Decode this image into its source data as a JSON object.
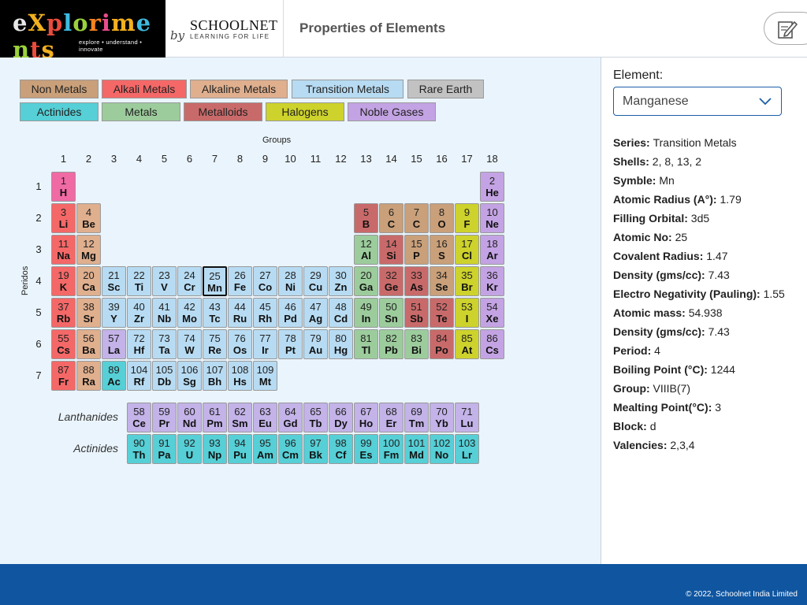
{
  "header": {
    "logo_text": "explorim",
    "logo_letters": [
      "e",
      "X",
      "p",
      "l",
      "o",
      "r",
      "i",
      "m",
      "e",
      "n",
      "t",
      "s"
    ],
    "logo_tagline": "explore • understand • innovate",
    "by_text": "by",
    "partner_name": "SCHOOLNET",
    "partner_tagline": "LEARNING FOR LIFE",
    "title": "Properties of Elements",
    "edit_icon": "pencil-notepad-icon"
  },
  "legend": [
    {
      "label": "Non Metals",
      "color": "#c9a07a"
    },
    {
      "label": "Alkali Metals",
      "color": "#f46868"
    },
    {
      "label": "Alkaline Metals",
      "color": "#dfaf8e"
    },
    {
      "label": "Transition Metals",
      "color": "#b7dbf2"
    },
    {
      "label": "Rare Earth",
      "color": "#c2c2c2"
    },
    {
      "label": "Actinides",
      "color": "#56cfd6"
    },
    {
      "label": "Metals",
      "color": "#9ccc9c"
    },
    {
      "label": "Metalloids",
      "color": "#c96a6a"
    },
    {
      "label": "Halogens",
      "color": "#cdd22c"
    },
    {
      "label": "Noble Gases",
      "color": "#c3a3e3"
    }
  ],
  "grid": {
    "groups_label": "Groups",
    "periods_label": "Peridos",
    "group_numbers": [
      "1",
      "2",
      "3",
      "4",
      "5",
      "6",
      "7",
      "8",
      "9",
      "10",
      "11",
      "12",
      "13",
      "14",
      "15",
      "16",
      "17",
      "18"
    ],
    "period_numbers": [
      "1",
      "2",
      "3",
      "4",
      "5",
      "6",
      "7"
    ],
    "lanthanides_label": "Lanthanides",
    "actinides_label": "Actinides"
  },
  "colors": {
    "H": "#f06aa4",
    "alkali": "#f46868",
    "alkaline": "#dfaf8e",
    "transition": "#b7dbf2",
    "nonmetal": "#c9a07a",
    "metal": "#9ccc9c",
    "metalloid": "#c96a6a",
    "halogen": "#cdd22c",
    "noble": "#c3a3e3",
    "lanthanide": "#c3b3e8",
    "actinide": "#56cfd6"
  },
  "elements": [
    {
      "n": "1",
      "s": "H",
      "g": 1,
      "p": 1,
      "c": "H"
    },
    {
      "n": "2",
      "s": "He",
      "g": 18,
      "p": 1,
      "c": "noble"
    },
    {
      "n": "3",
      "s": "Li",
      "g": 1,
      "p": 2,
      "c": "alkali"
    },
    {
      "n": "4",
      "s": "Be",
      "g": 2,
      "p": 2,
      "c": "alkaline"
    },
    {
      "n": "5",
      "s": "B",
      "g": 13,
      "p": 2,
      "c": "metalloid"
    },
    {
      "n": "6",
      "s": "C",
      "g": 14,
      "p": 2,
      "c": "nonmetal"
    },
    {
      "n": "7",
      "s": "C",
      "g": 15,
      "p": 2,
      "c": "nonmetal"
    },
    {
      "n": "8",
      "s": "O",
      "g": 16,
      "p": 2,
      "c": "nonmetal"
    },
    {
      "n": "9",
      "s": "F",
      "g": 17,
      "p": 2,
      "c": "halogen"
    },
    {
      "n": "10",
      "s": "Ne",
      "g": 18,
      "p": 2,
      "c": "noble"
    },
    {
      "n": "11",
      "s": "Na",
      "g": 1,
      "p": 3,
      "c": "alkali"
    },
    {
      "n": "12",
      "s": "Mg",
      "g": 2,
      "p": 3,
      "c": "alkaline"
    },
    {
      "n": "12",
      "s": "Al",
      "g": 13,
      "p": 3,
      "c": "metal"
    },
    {
      "n": "14",
      "s": "Si",
      "g": 14,
      "p": 3,
      "c": "metalloid"
    },
    {
      "n": "15",
      "s": "P",
      "g": 15,
      "p": 3,
      "c": "nonmetal"
    },
    {
      "n": "16",
      "s": "S",
      "g": 16,
      "p": 3,
      "c": "nonmetal"
    },
    {
      "n": "17",
      "s": "Cl",
      "g": 17,
      "p": 3,
      "c": "halogen"
    },
    {
      "n": "18",
      "s": "Ar",
      "g": 18,
      "p": 3,
      "c": "noble"
    },
    {
      "n": "19",
      "s": "K",
      "g": 1,
      "p": 4,
      "c": "alkali"
    },
    {
      "n": "20",
      "s": "Ca",
      "g": 2,
      "p": 4,
      "c": "alkaline"
    },
    {
      "n": "21",
      "s": "Sc",
      "g": 3,
      "p": 4,
      "c": "transition"
    },
    {
      "n": "22",
      "s": "Ti",
      "g": 4,
      "p": 4,
      "c": "transition"
    },
    {
      "n": "23",
      "s": "V",
      "g": 5,
      "p": 4,
      "c": "transition"
    },
    {
      "n": "24",
      "s": "Cr",
      "g": 6,
      "p": 4,
      "c": "transition"
    },
    {
      "n": "25",
      "s": "Mn",
      "g": 7,
      "p": 4,
      "c": "transition",
      "selected": true
    },
    {
      "n": "26",
      "s": "Fe",
      "g": 8,
      "p": 4,
      "c": "transition"
    },
    {
      "n": "27",
      "s": "Co",
      "g": 9,
      "p": 4,
      "c": "transition"
    },
    {
      "n": "28",
      "s": "Ni",
      "g": 10,
      "p": 4,
      "c": "transition"
    },
    {
      "n": "29",
      "s": "Cu",
      "g": 11,
      "p": 4,
      "c": "transition"
    },
    {
      "n": "30",
      "s": "Zn",
      "g": 12,
      "p": 4,
      "c": "transition"
    },
    {
      "n": "20",
      "s": "Ga",
      "g": 13,
      "p": 4,
      "c": "metal"
    },
    {
      "n": "32",
      "s": "Ge",
      "g": 14,
      "p": 4,
      "c": "metalloid"
    },
    {
      "n": "33",
      "s": "As",
      "g": 15,
      "p": 4,
      "c": "metalloid"
    },
    {
      "n": "34",
      "s": "Se",
      "g": 16,
      "p": 4,
      "c": "nonmetal"
    },
    {
      "n": "35",
      "s": "Br",
      "g": 17,
      "p": 4,
      "c": "halogen"
    },
    {
      "n": "36",
      "s": "Kr",
      "g": 18,
      "p": 4,
      "c": "noble"
    },
    {
      "n": "37",
      "s": "Rb",
      "g": 1,
      "p": 5,
      "c": "alkali"
    },
    {
      "n": "38",
      "s": "Sr",
      "g": 2,
      "p": 5,
      "c": "alkaline"
    },
    {
      "n": "39",
      "s": "Y",
      "g": 3,
      "p": 5,
      "c": "transition"
    },
    {
      "n": "40",
      "s": "Zr",
      "g": 4,
      "p": 5,
      "c": "transition"
    },
    {
      "n": "41",
      "s": "Nb",
      "g": 5,
      "p": 5,
      "c": "transition"
    },
    {
      "n": "42",
      "s": "Mo",
      "g": 6,
      "p": 5,
      "c": "transition"
    },
    {
      "n": "43",
      "s": "Tc",
      "g": 7,
      "p": 5,
      "c": "transition"
    },
    {
      "n": "44",
      "s": "Ru",
      "g": 8,
      "p": 5,
      "c": "transition"
    },
    {
      "n": "45",
      "s": "Rh",
      "g": 9,
      "p": 5,
      "c": "transition"
    },
    {
      "n": "46",
      "s": "Pd",
      "g": 10,
      "p": 5,
      "c": "transition"
    },
    {
      "n": "47",
      "s": "Ag",
      "g": 11,
      "p": 5,
      "c": "transition"
    },
    {
      "n": "48",
      "s": "Cd",
      "g": 12,
      "p": 5,
      "c": "transition"
    },
    {
      "n": "49",
      "s": "In",
      "g": 13,
      "p": 5,
      "c": "metal"
    },
    {
      "n": "50",
      "s": "Sn",
      "g": 14,
      "p": 5,
      "c": "metal"
    },
    {
      "n": "51",
      "s": "Sb",
      "g": 15,
      "p": 5,
      "c": "metalloid"
    },
    {
      "n": "52",
      "s": "Te",
      "g": 16,
      "p": 5,
      "c": "metalloid"
    },
    {
      "n": "53",
      "s": "I",
      "g": 17,
      "p": 5,
      "c": "halogen"
    },
    {
      "n": "54",
      "s": "Xe",
      "g": 18,
      "p": 5,
      "c": "noble"
    },
    {
      "n": "55",
      "s": "Cs",
      "g": 1,
      "p": 6,
      "c": "alkali"
    },
    {
      "n": "56",
      "s": "Ba",
      "g": 2,
      "p": 6,
      "c": "alkaline"
    },
    {
      "n": "57",
      "s": "La",
      "g": 3,
      "p": 6,
      "c": "lanthanide"
    },
    {
      "n": "72",
      "s": "Hf",
      "g": 4,
      "p": 6,
      "c": "transition"
    },
    {
      "n": "73",
      "s": "Ta",
      "g": 5,
      "p": 6,
      "c": "transition"
    },
    {
      "n": "74",
      "s": "W",
      "g": 6,
      "p": 6,
      "c": "transition"
    },
    {
      "n": "75",
      "s": "Re",
      "g": 7,
      "p": 6,
      "c": "transition"
    },
    {
      "n": "76",
      "s": "Os",
      "g": 8,
      "p": 6,
      "c": "transition"
    },
    {
      "n": "77",
      "s": "Ir",
      "g": 9,
      "p": 6,
      "c": "transition"
    },
    {
      "n": "78",
      "s": "Pt",
      "g": 10,
      "p": 6,
      "c": "transition"
    },
    {
      "n": "79",
      "s": "Au",
      "g": 11,
      "p": 6,
      "c": "transition"
    },
    {
      "n": "80",
      "s": "Hg",
      "g": 12,
      "p": 6,
      "c": "transition"
    },
    {
      "n": "81",
      "s": "Tl",
      "g": 13,
      "p": 6,
      "c": "metal"
    },
    {
      "n": "82",
      "s": "Pb",
      "g": 14,
      "p": 6,
      "c": "metal"
    },
    {
      "n": "83",
      "s": "Bi",
      "g": 15,
      "p": 6,
      "c": "metal"
    },
    {
      "n": "84",
      "s": "Po",
      "g": 16,
      "p": 6,
      "c": "metalloid"
    },
    {
      "n": "85",
      "s": "At",
      "g": 17,
      "p": 6,
      "c": "halogen"
    },
    {
      "n": "86",
      "s": "Cs",
      "g": 18,
      "p": 6,
      "c": "noble"
    },
    {
      "n": "87",
      "s": "Fr",
      "g": 1,
      "p": 7,
      "c": "alkali"
    },
    {
      "n": "88",
      "s": "Ra",
      "g": 2,
      "p": 7,
      "c": "alkaline"
    },
    {
      "n": "89",
      "s": "Ac",
      "g": 3,
      "p": 7,
      "c": "actinide"
    },
    {
      "n": "104",
      "s": "Rf",
      "g": 4,
      "p": 7,
      "c": "transition"
    },
    {
      "n": "105",
      "s": "Db",
      "g": 5,
      "p": 7,
      "c": "transition"
    },
    {
      "n": "106",
      "s": "Sg",
      "g": 6,
      "p": 7,
      "c": "transition"
    },
    {
      "n": "107",
      "s": "Bh",
      "g": 7,
      "p": 7,
      "c": "transition"
    },
    {
      "n": "108",
      "s": "Hs",
      "g": 8,
      "p": 7,
      "c": "transition"
    },
    {
      "n": "109",
      "s": "Mt",
      "g": 9,
      "p": 7,
      "c": "transition"
    }
  ],
  "lanthanides": [
    {
      "n": "58",
      "s": "Ce"
    },
    {
      "n": "59",
      "s": "Pr"
    },
    {
      "n": "60",
      "s": "Nd"
    },
    {
      "n": "61",
      "s": "Pm"
    },
    {
      "n": "62",
      "s": "Sm"
    },
    {
      "n": "63",
      "s": "Eu"
    },
    {
      "n": "64",
      "s": "Gd"
    },
    {
      "n": "65",
      "s": "Tb"
    },
    {
      "n": "66",
      "s": "Dy"
    },
    {
      "n": "67",
      "s": "Ho"
    },
    {
      "n": "68",
      "s": "Er"
    },
    {
      "n": "69",
      "s": "Tm"
    },
    {
      "n": "70",
      "s": "Yb"
    },
    {
      "n": "71",
      "s": "Lu"
    }
  ],
  "actinides": [
    {
      "n": "90",
      "s": "Th"
    },
    {
      "n": "91",
      "s": "Pa"
    },
    {
      "n": "92",
      "s": "U"
    },
    {
      "n": "93",
      "s": "Np"
    },
    {
      "n": "94",
      "s": "Pu"
    },
    {
      "n": "95",
      "s": "Am"
    },
    {
      "n": "96",
      "s": "Cm"
    },
    {
      "n": "97",
      "s": "Bk"
    },
    {
      "n": "98",
      "s": "Cf"
    },
    {
      "n": "99",
      "s": "Es"
    },
    {
      "n": "100",
      "s": "Fm"
    },
    {
      "n": "101",
      "s": "Md"
    },
    {
      "n": "102",
      "s": "No"
    },
    {
      "n": "103",
      "s": "Lr"
    }
  ],
  "panel": {
    "element_label": "Element:",
    "selected_element": "Manganese",
    "dropdown_icon": "chevron-down-icon",
    "properties": [
      {
        "key": "Series:",
        "value": "Transition Metals"
      },
      {
        "key": "Shells:",
        "value": "2, 8, 13, 2"
      },
      {
        "key": "Symble:",
        "value": "Mn"
      },
      {
        "key": "Atomic Radius (A°):",
        "value": "1.79"
      },
      {
        "key": "Filling Orbital:",
        "value": "3d5"
      },
      {
        "key": "Atomic No:",
        "value": "25"
      },
      {
        "key": "Covalent Radius:",
        "value": "1.47"
      },
      {
        "key": "Density (gms/cc):",
        "value": "7.43"
      },
      {
        "key": "Electro Negativity (Pauling):",
        "value": "1.55"
      },
      {
        "key": "Atomic mass:",
        "value": "54.938"
      },
      {
        "key": "Density (gms/cc):",
        "value": "7.43"
      },
      {
        "key": "Period:",
        "value": "4"
      },
      {
        "key": "Boiling Point (°C):",
        "value": "1244"
      },
      {
        "key": "Group:",
        "value": "VIIIB(7)"
      },
      {
        "key": "Mealting Point(°C):",
        "value": "3"
      },
      {
        "key": "Block:",
        "value": "d"
      },
      {
        "key": "Valencies:",
        "value": "2,3,4"
      }
    ]
  },
  "footer": {
    "copyright": "© 2022, Schoolnet India Limited"
  }
}
